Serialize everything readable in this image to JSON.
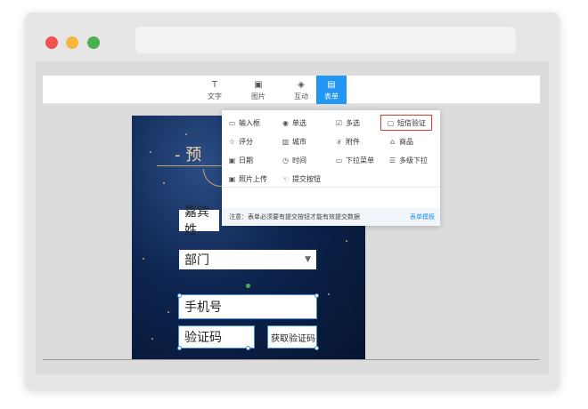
{
  "toolbar": {
    "items": [
      {
        "icon": "text-icon",
        "glyph": "T",
        "label": "文字"
      },
      {
        "icon": "image-icon",
        "glyph": "▣",
        "label": "图片"
      },
      {
        "icon": "interact-icon",
        "glyph": "◈",
        "label": "互动"
      },
      {
        "icon": "form-icon",
        "glyph": "▤",
        "label": "表单"
      }
    ]
  },
  "menu": {
    "items": [
      {
        "icon": "input-box-icon",
        "glyph": "▭",
        "label": "输入框"
      },
      {
        "icon": "radio-icon",
        "glyph": "◉",
        "label": "单选"
      },
      {
        "icon": "checkbox-icon",
        "glyph": "☑",
        "label": "多选"
      },
      {
        "icon": "sms-icon",
        "glyph": "▢",
        "label": "短信验证"
      },
      {
        "icon": "star-icon",
        "glyph": "☆",
        "label": "评分"
      },
      {
        "icon": "city-icon",
        "glyph": "▥",
        "label": "城市"
      },
      {
        "icon": "attachment-icon",
        "glyph": "∂",
        "label": "附件"
      },
      {
        "icon": "product-icon",
        "glyph": "⌂",
        "label": "商品"
      },
      {
        "icon": "date-icon",
        "glyph": "▣",
        "label": "日期"
      },
      {
        "icon": "clock-icon",
        "glyph": "◷",
        "label": "时间"
      },
      {
        "icon": "dropdown-icon",
        "glyph": "▭",
        "label": "下拉菜单"
      },
      {
        "icon": "multi-dropdown-icon",
        "glyph": "☰",
        "label": "多级下拉"
      },
      {
        "icon": "camera-icon",
        "glyph": "▣",
        "label": "照片上传"
      },
      {
        "icon": "submit-icon",
        "glyph": "☜",
        "label": "提交按钮"
      }
    ],
    "notice": "注意：表单必须要有提交按钮才能有效提交数据",
    "template_link": "表单模板"
  },
  "poster": {
    "title": "- 预",
    "guest_field": "嘉宾姓",
    "dept_field": "部门",
    "dept_arrow": "▼",
    "phone_field": "手机号",
    "code_field": "验证码",
    "get_code_button": "获取验证码"
  },
  "colors": {
    "accent": "#2196f3",
    "highlight": "#e53935",
    "poster_bg": "#0d2450"
  }
}
